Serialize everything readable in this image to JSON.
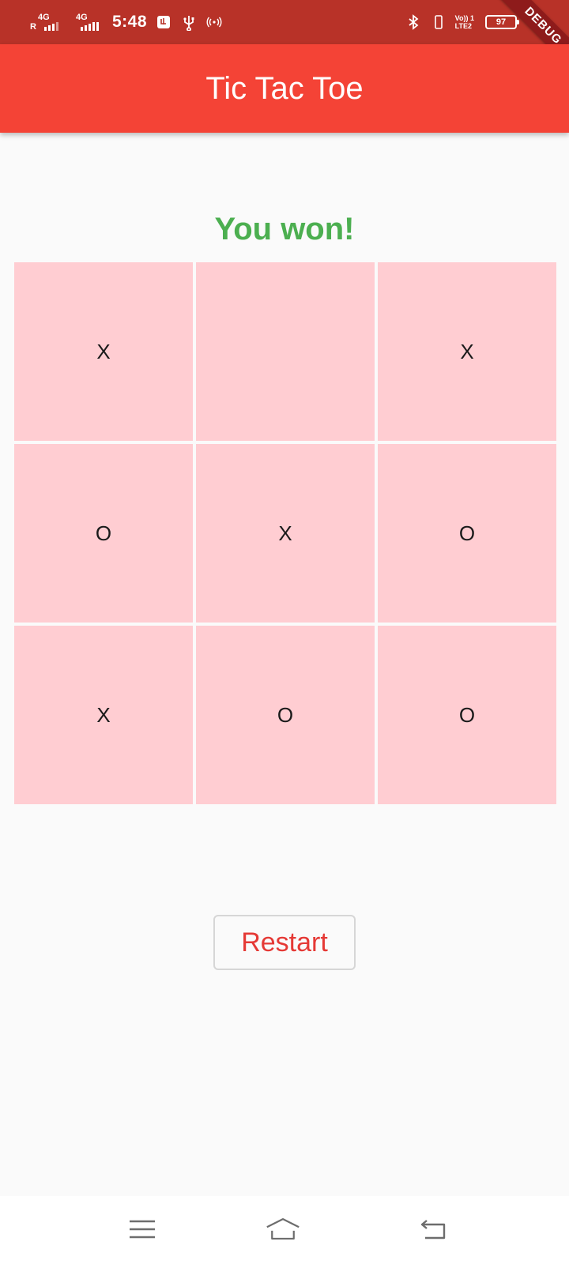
{
  "status_bar": {
    "time": "5:48",
    "network_1_label": "4G",
    "network_1_roaming": "R",
    "network_2_label": "4G",
    "volte_line1": "Vo)) 1",
    "volte_line2": "LTE2",
    "battery_level": "97",
    "icons": [
      "usb-debug-icon",
      "usb-icon",
      "hotspot-icon",
      "bluetooth-icon",
      "vibrate-icon",
      "charging-icon"
    ]
  },
  "debug_banner": "DEBUG",
  "app_bar": {
    "title": "Tic Tac Toe",
    "color": "#f44336"
  },
  "game": {
    "result": "You won!",
    "result_color": "#4caf50",
    "cell_color": "#ffcdd2",
    "board": [
      [
        "X",
        "",
        "X"
      ],
      [
        "O",
        "X",
        "O"
      ],
      [
        "X",
        "O",
        "O"
      ]
    ]
  },
  "restart_button": {
    "label": "Restart",
    "color": "#e53935"
  },
  "nav_bar": {
    "buttons": [
      "menu-icon",
      "home-icon",
      "back-icon"
    ]
  }
}
